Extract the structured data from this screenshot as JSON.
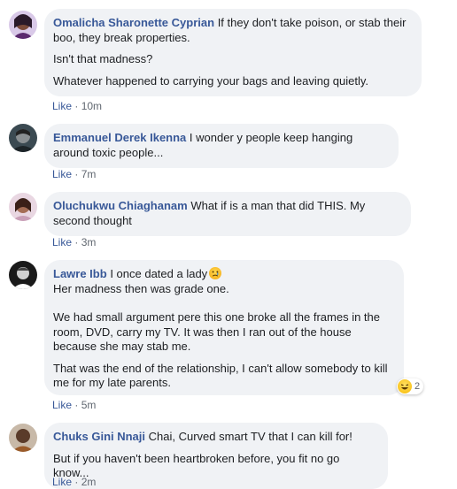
{
  "comments": [
    {
      "author": "Omalicha Sharonette Cyprian",
      "first": "If they don't take poison, or stab their boo, they break properties.",
      "p2": "Isn't that madness?",
      "p3": "Whatever happened to carrying your bags and leaving quietly.",
      "like": "Like",
      "sep": "·",
      "time": "10m"
    },
    {
      "author": "Emmanuel Derek Ikenna",
      "first": "I wonder y people keep hanging around toxic people...",
      "like": "Like",
      "sep": "·",
      "time": "7m"
    },
    {
      "author": "Oluchukwu Chiaghanam",
      "first": "What if is a man that did THIS. My second thought",
      "like": "Like",
      "sep": "·",
      "time": "3m"
    },
    {
      "author": "Lawre Ibb",
      "first": "I once dated a lady",
      "line2": "Her madness then was grade one.",
      "p2": "We had small argument pere this one broke all the frames in the room, DVD, carry my TV. It was then I ran out of the house because she may stab me.",
      "p3": "That was the end of the relationship, I can't allow somebody to kill me for my late parents.",
      "like": "Like",
      "sep": "·",
      "time": "5m",
      "reaction_count": "2",
      "inline_emoji": "sad-face-emoji",
      "reaction_icon": "laughing-emoji"
    },
    {
      "author": "Chuks Gini Nnaji",
      "first": "Chai, Curved smart TV that I can kill for!",
      "p2": "But if you haven't been heartbroken before, you fit no go know...",
      "like": "Like",
      "sep": "·",
      "time": "2m"
    }
  ],
  "colors": {
    "author": "#385898",
    "bubble": "#f0f2f5",
    "meta": "#606770"
  }
}
